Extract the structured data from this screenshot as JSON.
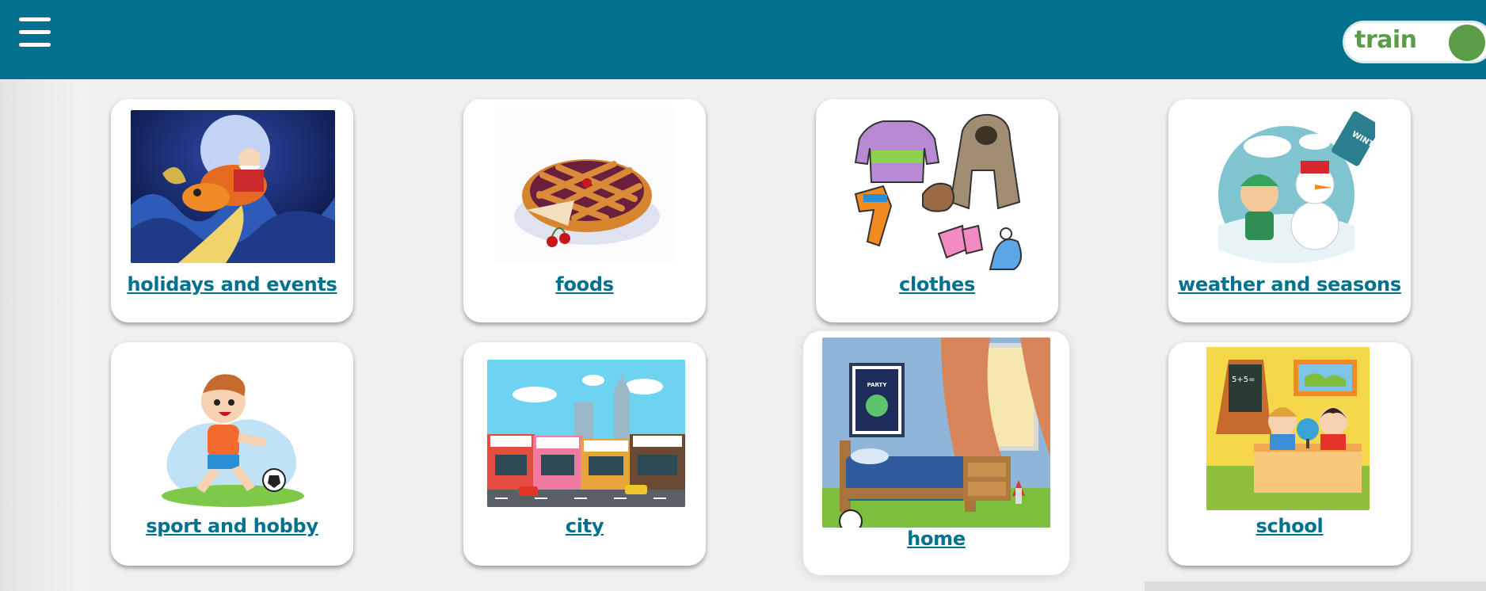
{
  "header": {
    "menu_icon": "hamburger-icon",
    "toggle_label": "train",
    "bar_color": "#01728e",
    "toggle_color": "#5b9c49"
  },
  "categories": [
    {
      "label": "holidays and events",
      "image": "santa-sleigh-illustration"
    },
    {
      "label": "foods",
      "image": "cherry-pie-illustration"
    },
    {
      "label": "clothes",
      "image": "winter-clothes-illustration"
    },
    {
      "label": "weather and seasons",
      "image": "winter-snowman-illustration"
    },
    {
      "label": "sport and hobby",
      "image": "boy-playing-soccer-illustration"
    },
    {
      "label": "city",
      "image": "city-street-illustration"
    },
    {
      "label": "home",
      "image": "bedroom-illustration"
    },
    {
      "label": "school",
      "image": "classroom-kids-illustration"
    }
  ]
}
